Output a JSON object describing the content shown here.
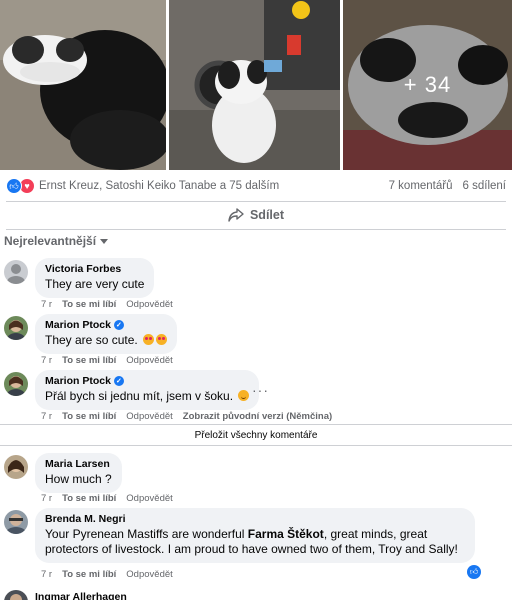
{
  "photos": {
    "more_count": "+ 34"
  },
  "reactions": {
    "names": "Ernst Kreuz, Satoshi Keiko Tanabe a 75 dalším",
    "comments_count": "7 komentářů",
    "shares_count": "6 sdílení"
  },
  "share": {
    "label": "Sdílet"
  },
  "sort": {
    "label": "Nejrelevantnější"
  },
  "comments": [
    {
      "name": "Victoria Forbes",
      "text": "They are very cute",
      "time": "7 r",
      "like": "To se mi líbí",
      "reply": "Odpovědět"
    },
    {
      "name": "Marion Ptock",
      "text": "They are so cute.",
      "time": "7 r",
      "like": "To se mi líbí",
      "reply": "Odpovědět"
    },
    {
      "name": "Marion Ptock",
      "text": "Přál bych si jednu mít, jsem v šoku.",
      "time": "7 r",
      "like": "To se mi líbí",
      "reply": "Odpovědět",
      "original": "Zobrazit původní verzi (Němčina)"
    },
    {
      "name": "Maria Larsen",
      "text": "How much ?",
      "time": "7 r",
      "like": "To se mi líbí",
      "reply": "Odpovědět"
    },
    {
      "name": "Brenda M. Negri",
      "text_pre": "Your Pyrenean Mastiffs are wonderful ",
      "text_mark": "Farma Štěkot",
      "text_post": ", great minds, great protectors of livestock. I am proud to have owned two of them, Troy and Sally!",
      "time": "7 r",
      "like": "To se mi líbí",
      "reply": "Odpovědět"
    },
    {
      "name": "Ingmar Allerhagen"
    }
  ],
  "translate_all": "Přeložit všechny komentáře",
  "colors": {
    "accent": "#1877f2",
    "love": "#f33e58",
    "bubble": "#f0f2f5",
    "muted": "#65676b"
  }
}
